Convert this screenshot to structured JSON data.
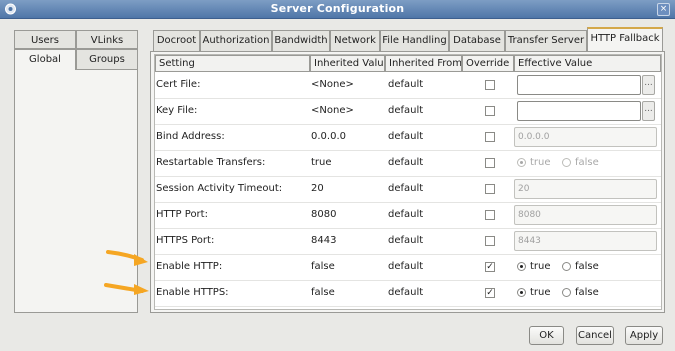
{
  "window": {
    "title": "Server Configuration"
  },
  "left_tabs": [
    {
      "label": "Users"
    },
    {
      "label": "VLinks"
    },
    {
      "label": "Global"
    },
    {
      "label": "Groups"
    }
  ],
  "right_tabs": [
    {
      "label": "Docroot"
    },
    {
      "label": "Authorization"
    },
    {
      "label": "Bandwidth"
    },
    {
      "label": "Network"
    },
    {
      "label": "File Handling"
    },
    {
      "label": "Database"
    },
    {
      "label": "Transfer Server"
    },
    {
      "label": "HTTP Fallback"
    }
  ],
  "table": {
    "headers": [
      "Setting",
      "Inherited Value",
      "Inherited From",
      "Override",
      "Effective Value"
    ],
    "rows": [
      {
        "setting": "Cert File:",
        "inherited_value": "<None>",
        "inherited_from": "default",
        "override": false,
        "effective": "",
        "effective_type": "file"
      },
      {
        "setting": "Key File:",
        "inherited_value": "<None>",
        "inherited_from": "default",
        "override": false,
        "effective": "",
        "effective_type": "file"
      },
      {
        "setting": "Bind Address:",
        "inherited_value": "0.0.0.0",
        "inherited_from": "default",
        "override": false,
        "effective": "0.0.0.0",
        "effective_type": "text-disabled"
      },
      {
        "setting": "Restartable Transfers:",
        "inherited_value": "true",
        "inherited_from": "default",
        "override": false,
        "effective": "true",
        "effective_type": "radio-disabled"
      },
      {
        "setting": "Session Activity Timeout:",
        "inherited_value": "20",
        "inherited_from": "default",
        "override": false,
        "effective": "20",
        "effective_type": "text-disabled"
      },
      {
        "setting": "HTTP Port:",
        "inherited_value": "8080",
        "inherited_from": "default",
        "override": false,
        "effective": "8080",
        "effective_type": "text-disabled"
      },
      {
        "setting": "HTTPS Port:",
        "inherited_value": "8443",
        "inherited_from": "default",
        "override": false,
        "effective": "8443",
        "effective_type": "text-disabled"
      },
      {
        "setting": "Enable HTTP:",
        "inherited_value": "false",
        "inherited_from": "default",
        "override": true,
        "effective": "true",
        "effective_type": "radio"
      },
      {
        "setting": "Enable HTTPS:",
        "inherited_value": "false",
        "inherited_from": "default",
        "override": true,
        "effective": "true",
        "effective_type": "radio"
      }
    ],
    "radio_labels": {
      "true": "true",
      "false": "false"
    },
    "browse_label": "..."
  },
  "buttons": {
    "ok": "OK",
    "cancel": "Cancel",
    "apply": "Apply"
  },
  "annotations": {
    "arrow_color": "#f5a623",
    "arrow_rows": [
      "Enable HTTP:",
      "Enable HTTPS:"
    ]
  },
  "colors": {
    "titlebar": "#5a7fb0",
    "active_tab_accent": "#d4a84a"
  }
}
